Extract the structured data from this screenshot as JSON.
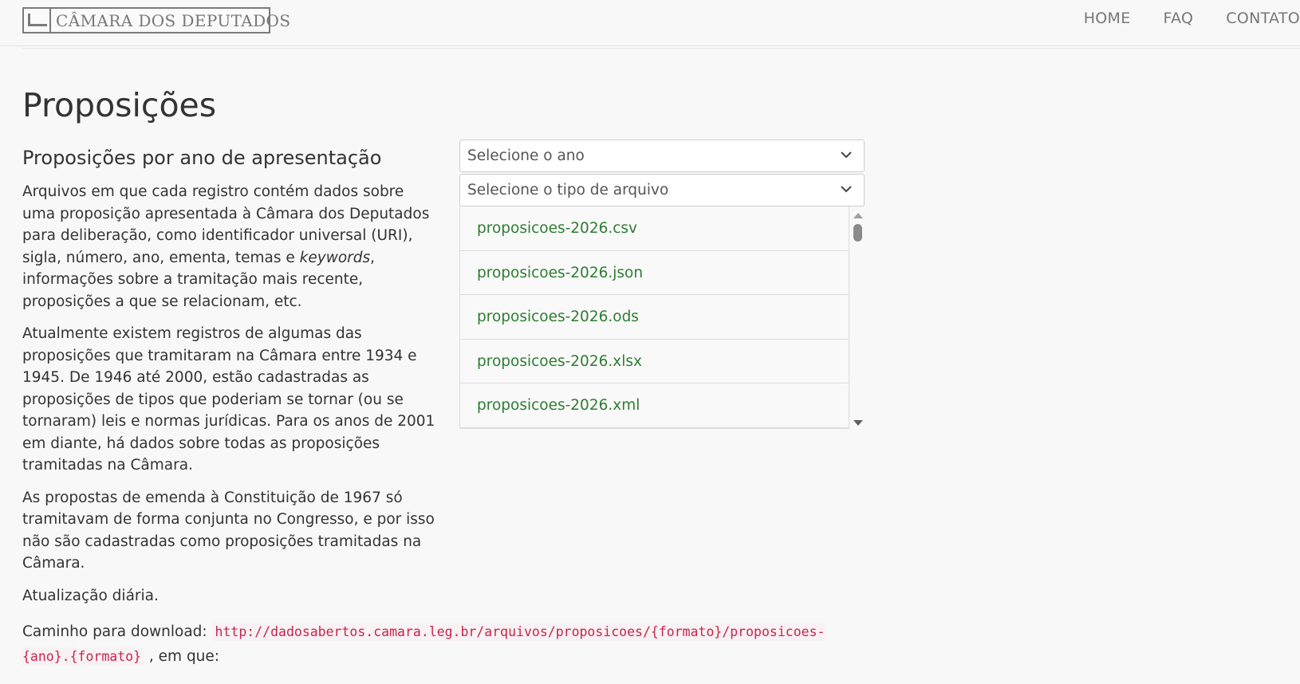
{
  "header": {
    "logo_text": "CÂMARA DOS DEPUTADOS",
    "nav": [
      "HOME",
      "FAQ",
      "CONTATO"
    ]
  },
  "page": {
    "title": "Proposições",
    "section_title": "Proposições por ano de apresentação",
    "paragraphs": {
      "p1_before": "Arquivos em que cada registro contém dados sobre uma proposição apresentada à Câmara dos Deputados para deliberação, como identificador universal (URI), sigla, número, ano, ementa, temas e ",
      "p1_em": "keywords",
      "p1_after": ", informações sobre a tramitação mais recente, proposições a que se relacionam, etc.",
      "p2": "Atualmente existem registros de algumas das proposições que tramitaram na Câmara entre 1934 e 1945. De 1946 até 2000, estão cadastradas as proposições de tipos que poderiam se tornar (ou se tornaram) leis e normas jurídicas. Para os anos de 2001 em diante, há dados sobre todas as proposições tramitadas na Câmara.",
      "p3": "As propostas de emenda à Constituição de 1967 só tramitavam de forma conjunta no Congresso, e por isso não são cadastradas como proposições tramitadas na Câmara.",
      "p4": "Atualização diária."
    },
    "download": {
      "label": "Caminho para download: ",
      "path": "http://dadosabertos.camara.leg.br/arquivos/proposicoes/{formato}/proposicoes-{ano}.{formato}",
      "suffix": " , em que:"
    }
  },
  "selects": {
    "year_placeholder": "Selecione o ano",
    "type_placeholder": "Selecione o tipo de arquivo"
  },
  "files": [
    "proposicoes-2026.csv",
    "proposicoes-2026.json",
    "proposicoes-2026.ods",
    "proposicoes-2026.xlsx",
    "proposicoes-2026.xml"
  ],
  "colors": {
    "link_green": "#2e7d32",
    "code_red": "#c7254e",
    "code_bg": "#f9f2f4",
    "background": "#f8f8f8"
  }
}
